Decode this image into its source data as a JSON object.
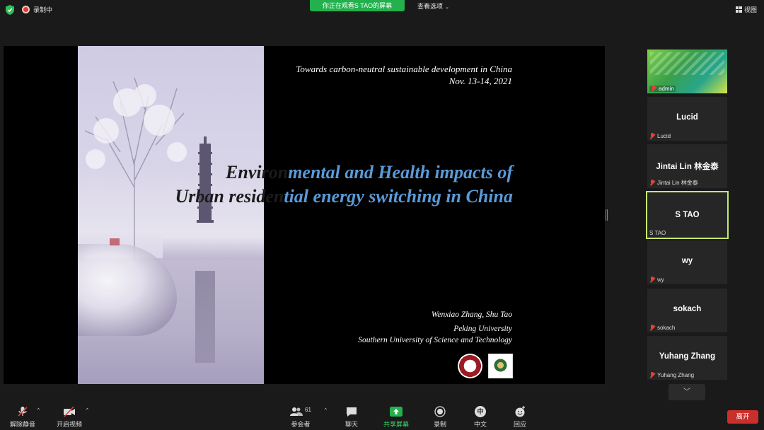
{
  "topbar": {
    "recording_label": "录制中",
    "viewing_label": "你正在观看S TAO的屏幕",
    "view_options_label": "查看选项",
    "view_label": "视图"
  },
  "slide": {
    "conference": "Towards carbon-neutral sustainable development in China",
    "date": "Nov. 13-14, 2021",
    "title_line1_dark": "Environ",
    "title_line1_blue": "mental and Health impacts of",
    "title_line2_dark": "Urban residen",
    "title_line2_blue": "tial energy switching in China",
    "authors": "Wenxiao Zhang, Shu Tao",
    "affiliation1": "Peking University",
    "affiliation2": "Southern University of Science and Technology"
  },
  "participants": [
    {
      "display": "",
      "name": "admin"
    },
    {
      "display": "Lucid",
      "name": "Lucid"
    },
    {
      "display": "Jintai  Lin 林金泰",
      "name": "Jintai Lin 林金泰"
    },
    {
      "display": "S TAO",
      "name": "S TAO"
    },
    {
      "display": "wy",
      "name": "wy"
    },
    {
      "display": "sokach",
      "name": "sokach"
    },
    {
      "display": "Yuhang Zhang",
      "name": "Yuhang Zhang"
    }
  ],
  "toolbar": {
    "unmute": "解除静音",
    "start_video": "开启视频",
    "participants": "参会者",
    "participants_count": "61",
    "chat": "聊天",
    "share_screen": "共享屏幕",
    "record": "录制",
    "language": "中文",
    "language_glyph": "中",
    "reactions": "回应",
    "leave": "离开"
  },
  "colors": {
    "share_green": "#23b14d",
    "active_speaker_border": "#c9e86a",
    "leave_red": "#c9302c",
    "title_blue": "#5a9ad8"
  }
}
